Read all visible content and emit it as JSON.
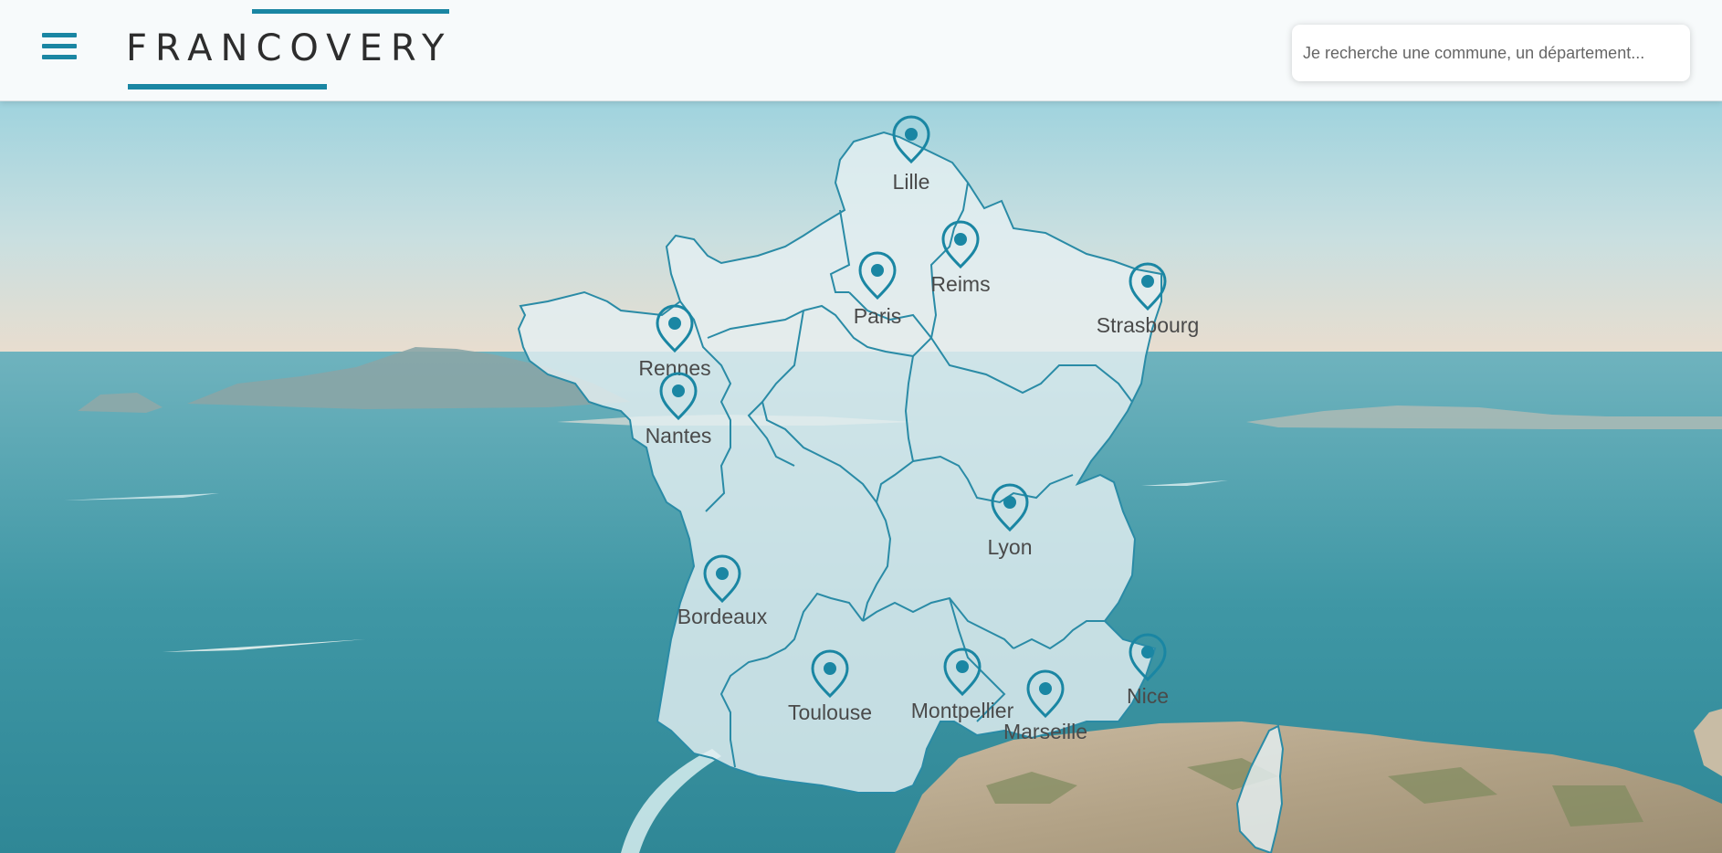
{
  "header": {
    "logo_text": "FRANCOVERY",
    "search_placeholder": "Je recherche une commune, un département..."
  },
  "icons": {
    "menu": "hamburger-menu-icon",
    "pin": "map-pin-icon"
  },
  "colors": {
    "accent": "#1a86a3",
    "map_fill": "#e4eff2",
    "label": "#4a4a4a"
  },
  "cities": [
    {
      "name": "Lille"
    },
    {
      "name": "Reims"
    },
    {
      "name": "Paris"
    },
    {
      "name": "Strasbourg"
    },
    {
      "name": "Rennes"
    },
    {
      "name": "Nantes"
    },
    {
      "name": "Lyon"
    },
    {
      "name": "Bordeaux"
    },
    {
      "name": "Toulouse"
    },
    {
      "name": "Montpellier"
    },
    {
      "name": "Marseille"
    },
    {
      "name": "Nice"
    }
  ]
}
